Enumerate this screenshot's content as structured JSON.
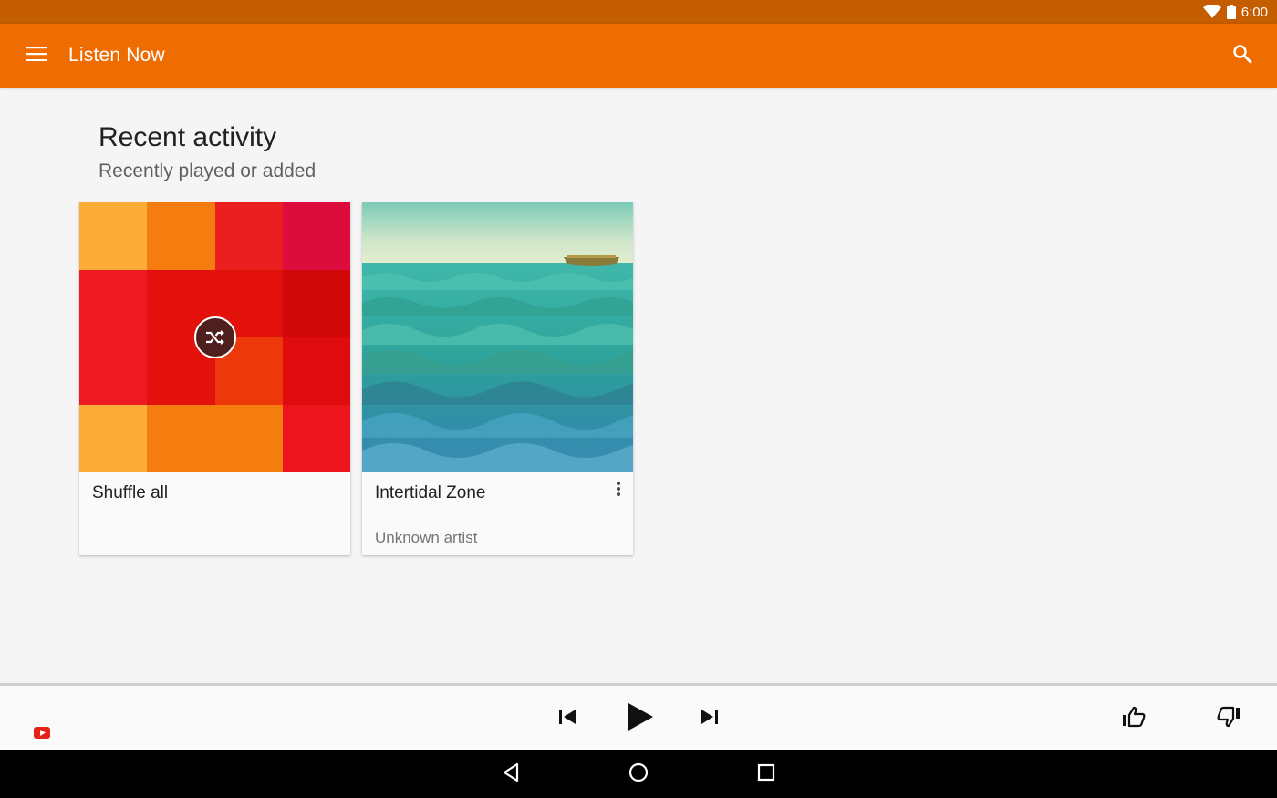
{
  "status_bar": {
    "time": "6:00",
    "icons": [
      "wifi-icon",
      "battery-icon"
    ]
  },
  "app_bar": {
    "title": "Listen Now",
    "left_icon": "menu-icon",
    "right_icon": "search-icon",
    "color": "#ef6c00"
  },
  "section": {
    "title": "Recent activity",
    "subtitle": "Recently played or added"
  },
  "cards": [
    {
      "title": "Shuffle all",
      "subtitle": "",
      "art": "color-mosaic-with-shuffle-icon"
    },
    {
      "title": "Intertidal Zone",
      "subtitle": "Unknown artist",
      "art": "sea-waves-illustration-with-boat"
    }
  ],
  "player": {
    "left_icon": "youtube-icon",
    "controls": [
      "skip-previous-icon",
      "play-icon",
      "skip-next-icon"
    ],
    "right_controls": [
      "thumbs-up-icon",
      "thumbs-down-icon"
    ]
  },
  "system_nav": {
    "buttons": [
      "back-icon",
      "home-icon",
      "recents-icon"
    ]
  }
}
